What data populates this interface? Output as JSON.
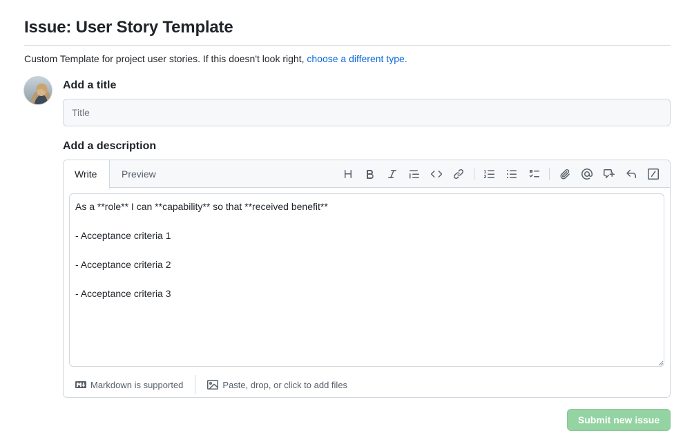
{
  "page": {
    "title": "Issue: User Story Template",
    "intro_text": "Custom Template for project user stories. If this doesn't look right, ",
    "intro_link": "choose a different type."
  },
  "form": {
    "title_label": "Add a title",
    "title_placeholder": "Title",
    "title_value": "",
    "description_label": "Add a description"
  },
  "editor": {
    "tabs": [
      {
        "label": "Write",
        "active": true
      },
      {
        "label": "Preview",
        "active": false
      }
    ],
    "toolbar_icons": [
      "heading-icon",
      "bold-icon",
      "italic-icon",
      "quote-icon",
      "code-icon",
      "link-icon",
      "ordered-list-icon",
      "unordered-list-icon",
      "task-list-icon",
      "attach-icon",
      "mention-icon",
      "reference-icon",
      "reply-icon",
      "slash-command-icon"
    ],
    "body": "As a **role** I can **capability** so that **received benefit**\n\n- Acceptance criteria 1\n\n- Acceptance criteria 2\n\n- Acceptance criteria 3",
    "footer": {
      "markdown_note": "Markdown is supported",
      "attach_note": "Paste, drop, or click to add files"
    }
  },
  "actions": {
    "submit_label": "Submit new issue"
  },
  "colors": {
    "link": "#0969da",
    "submit_disabled": "#94d3a2",
    "border": "#d0d7de",
    "muted": "#57606a"
  }
}
